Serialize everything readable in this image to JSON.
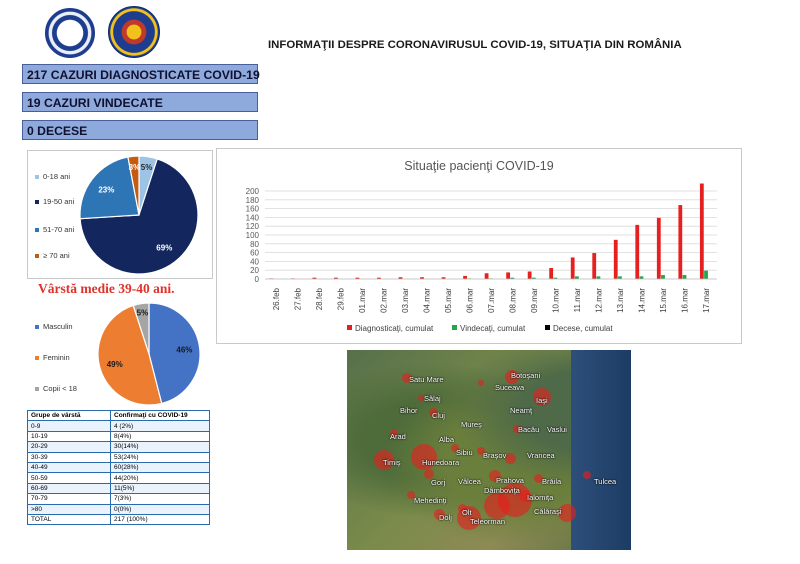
{
  "header": {
    "title": "INFORMAŢII DESPRE CORONAVIRUSUL COVID-19, SITUAŢIA DIN ROMÂNIA",
    "logo_left_text": "GUVERNUL ROMÂNIEI",
    "logo_right_text": "MINISTERUL AFACERILOR INTERNE"
  },
  "stats": {
    "diagnosed": "217 CAZURI DIAGNOSTICATE COVID-19",
    "recovered": "19 CAZURI VINDECATE",
    "deaths": "0 DECESE"
  },
  "colors": {
    "stat_bar": "#8ea9db",
    "age_0_18": "#9dc3e6",
    "age_19_50": "#13275e",
    "age_51_70": "#2e75b6",
    "age_over_70": "#c55a11",
    "male": "#4472c4",
    "female": "#ed7d31",
    "children": "#a5a5a5",
    "diagnosed": "#e5201e",
    "recovered": "#22a84a",
    "deaths": "#000000"
  },
  "age_pie": {
    "legend": [
      "0-18 ani",
      "19-50 ani",
      "51-70 ani",
      "≥ 70 ani"
    ],
    "values": [
      5,
      69,
      23,
      3
    ],
    "labels": [
      "5%",
      "69%",
      "23%",
      "3%"
    ]
  },
  "average_age": "Vârstă medie 39-40 ani.",
  "gender_pie": {
    "legend": [
      "Masculin",
      "Feminin",
      "Copii < 18"
    ],
    "values": [
      46,
      49,
      5
    ],
    "labels": [
      "46%",
      "49%",
      "5%"
    ]
  },
  "age_table": {
    "headers": [
      "Grupe de vârstă",
      "Confirmaţi cu COVID-19"
    ],
    "rows": [
      [
        "0-9",
        "4 (2%)"
      ],
      [
        "10-19",
        "8(4%)"
      ],
      [
        "20-29",
        "30(14%)"
      ],
      [
        "30-39",
        "53(24%)"
      ],
      [
        "40-49",
        "60(28%)"
      ],
      [
        "50-59",
        "44(20%)"
      ],
      [
        "60-69",
        "11(5%)"
      ],
      [
        "70-79",
        "7(3%)"
      ],
      [
        ">80",
        "0(0%)"
      ],
      [
        "TOTAL",
        "217 (100%)"
      ]
    ]
  },
  "chart_data": [
    {
      "type": "bar",
      "title": "Situaţie pacienţi COVID-19",
      "categories": [
        "26.feb",
        "27.feb",
        "28.feb",
        "29.feb",
        "01.mar",
        "02.mar",
        "03.mar",
        "04.mar",
        "05.mar",
        "06.mar",
        "07.mar",
        "08.mar",
        "09.mar",
        "10.mar",
        "11.mar",
        "12.mar",
        "13.mar",
        "14.mar",
        "15.mar",
        "16.mar",
        "17.mar"
      ],
      "ylim": [
        0,
        200
      ],
      "yticks": [
        0,
        20,
        40,
        60,
        80,
        100,
        120,
        140,
        160,
        180,
        200
      ],
      "grid": true,
      "legend_position": "bottom",
      "series": [
        {
          "name": "Diagnosticaţi, cumulat",
          "values": [
            1,
            1,
            3,
            3,
            3,
            3,
            4,
            4,
            4,
            7,
            13,
            15,
            17,
            25,
            49,
            59,
            89,
            123,
            139,
            168,
            217
          ]
        },
        {
          "name": "Vindecaţi, cumulat",
          "values": [
            0,
            0,
            0,
            0,
            0,
            0,
            0,
            0,
            0,
            1,
            1,
            3,
            3,
            3,
            6,
            6,
            6,
            6,
            9,
            9,
            19
          ]
        },
        {
          "name": "Decese, cumulat",
          "values": [
            0,
            0,
            0,
            0,
            0,
            0,
            0,
            0,
            0,
            0,
            0,
            0,
            0,
            0,
            0,
            0,
            0,
            0,
            0,
            0,
            0
          ]
        }
      ]
    },
    {
      "type": "pie",
      "categories": [
        "0-18 ani",
        "19-50 ani",
        "51-70 ani",
        "≥ 70 ani"
      ],
      "values": [
        5,
        69,
        23,
        3
      ],
      "legend_position": "left"
    },
    {
      "type": "pie",
      "categories": [
        "Masculin",
        "Feminin",
        "Copii < 18"
      ],
      "values": [
        46,
        49,
        5
      ],
      "legend_position": "left"
    }
  ],
  "map": {
    "labels": [
      "Satu Mare",
      "Botoşani",
      "Suceava",
      "Sălaj",
      "Iaşi",
      "Bihor",
      "Cluj",
      "Neamţ",
      "Mureş",
      "Bacău",
      "Vaslui",
      "Arad",
      "Alba",
      "Sibiu",
      "Braşov",
      "Vrancea",
      "Timiş",
      "Hunedoara",
      "Gorj",
      "Vâlcea",
      "Prahova",
      "Brăila",
      "Tulcea",
      "Dâmboviţa",
      "Mehedinţi",
      "Ialomiţa",
      "Olt",
      "Călăraşi",
      "Dolj",
      "Teleorman"
    ]
  }
}
